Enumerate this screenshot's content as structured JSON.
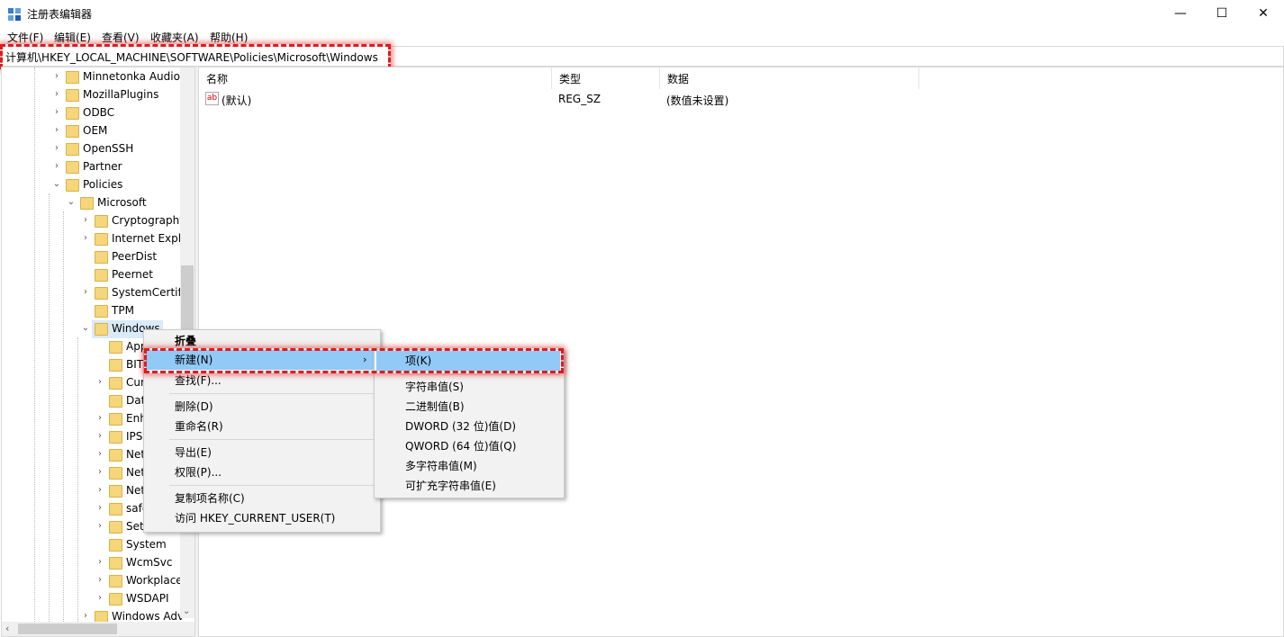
{
  "window": {
    "title": "注册表编辑器",
    "minimize_glyph": "—",
    "maximize_glyph": "☐",
    "close_glyph": "✕"
  },
  "menubar": {
    "items": [
      "文件(F)",
      "编辑(E)",
      "查看(V)",
      "收藏夹(A)",
      "帮助(H)"
    ]
  },
  "address": {
    "path": "计算机\\HKEY_LOCAL_MACHINE\\SOFTWARE\\Policies\\Microsoft\\Windows"
  },
  "tree": {
    "items": [
      {
        "label": "Minnetonka Audio"
      },
      {
        "label": "MozillaPlugins"
      },
      {
        "label": "ODBC"
      },
      {
        "label": "OEM"
      },
      {
        "label": "OpenSSH"
      },
      {
        "label": "Partner"
      },
      {
        "label": "Policies"
      },
      {
        "label": "Microsoft"
      },
      {
        "label": "Cryptography"
      },
      {
        "label": "Internet Explo"
      },
      {
        "label": "PeerDist"
      },
      {
        "label": "Peernet"
      },
      {
        "label": "SystemCertifi"
      },
      {
        "label": "TPM"
      },
      {
        "label": "Windows"
      },
      {
        "label": "App"
      },
      {
        "label": "BIT"
      },
      {
        "label": "Cur"
      },
      {
        "label": "Dat"
      },
      {
        "label": "Enh"
      },
      {
        "label": "IPSe"
      },
      {
        "label": "Net"
      },
      {
        "label": "Net"
      },
      {
        "label": "Net"
      },
      {
        "label": "safe"
      },
      {
        "label": "Setti"
      },
      {
        "label": "System"
      },
      {
        "label": "WcmSvc"
      },
      {
        "label": "Workplace"
      },
      {
        "label": "WSDAPI"
      },
      {
        "label": "Windows Adv"
      }
    ]
  },
  "list": {
    "columns": [
      "名称",
      "类型",
      "数据"
    ],
    "rows": [
      {
        "name": "(默认)",
        "type": "REG_SZ",
        "data": "(数值未设置)",
        "icon": "ab"
      }
    ]
  },
  "context_menu": {
    "items": [
      "折叠",
      "新建(N)",
      "查找(F)...",
      "删除(D)",
      "重命名(R)",
      "导出(E)",
      "权限(P)...",
      "复制项名称(C)",
      "访问 HKEY_CURRENT_USER(T)"
    ],
    "arrow": "›"
  },
  "submenu": {
    "items": [
      "项(K)",
      "字符串值(S)",
      "二进制值(B)",
      "DWORD (32 位)值(D)",
      "QWORD (64 位)值(Q)",
      "多字符串值(M)",
      "可扩充字符串值(E)"
    ]
  },
  "colors": {
    "highlight_border": "#e01b1b",
    "menu_hover": "#91c9f7",
    "folder": "#f5d67a"
  }
}
